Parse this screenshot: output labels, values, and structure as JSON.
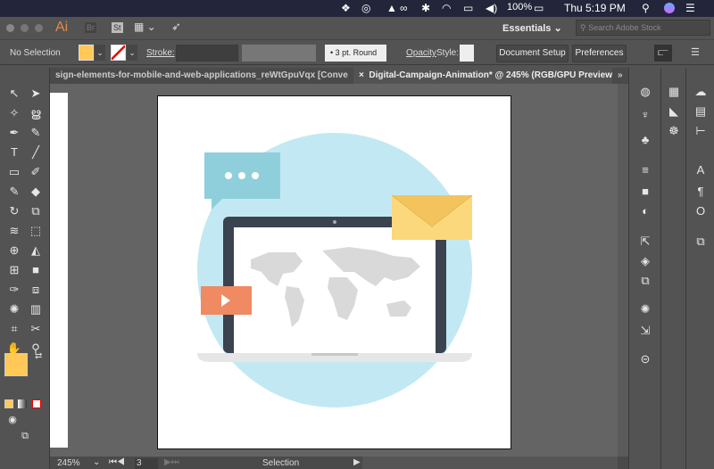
{
  "menubar": {
    "battery": "100%",
    "clock": "Thu 5:19 PM"
  },
  "appbar": {
    "logo": "Ai",
    "bridge": "Br",
    "stock": "St",
    "workspace": "Essentials",
    "search_placeholder": "Search Adobe Stock"
  },
  "control": {
    "selection": "No Selection",
    "stroke_label": "Stroke:",
    "brush": "3 pt. Round",
    "opacity_label": "Opacity",
    "style_label": "Style:",
    "doc_setup": "Document Setup",
    "preferences": "Preferences",
    "fill_color": "#ffc857"
  },
  "tabs": [
    {
      "label": "sign-elements-for-mobile-and-web-applications_reWtGpuVqx [Converted].eps"
    },
    {
      "label": "Digital-Campaign-Animation* @ 245% (RGB/GPU Preview)",
      "close": "×"
    }
  ],
  "status": {
    "zoom": "245%",
    "artboard": "3",
    "tool": "Selection"
  }
}
